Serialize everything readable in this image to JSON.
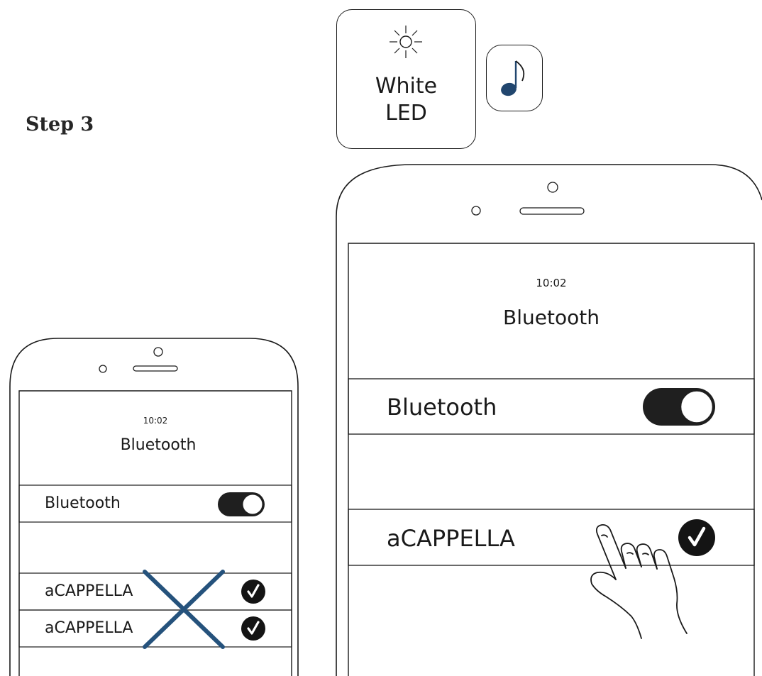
{
  "step": {
    "title": "Step 3"
  },
  "led": {
    "line1": "White",
    "line2": "LED"
  },
  "icons": {
    "sun": "sun-icon",
    "note": "music-note-icon",
    "check": "check-icon",
    "hand": "pointing-hand-icon",
    "cross": "cross-mark-icon"
  },
  "colors": {
    "note_blue": "#21466e",
    "cross_blue": "#25527c",
    "toggle_dark": "#1f1f1f"
  },
  "phone_small": {
    "time": "10:02",
    "screen_title": "Bluetooth",
    "toggle_row_label": "Bluetooth",
    "toggle_on": true,
    "devices": [
      {
        "label": "aCAPPELLA"
      },
      {
        "label": "aCAPPELLA"
      }
    ]
  },
  "phone_large": {
    "time": "10:02",
    "screen_title": "Bluetooth",
    "toggle_row_label": "Bluetooth",
    "toggle_on": true,
    "devices": [
      {
        "label": "aCAPPELLA"
      }
    ]
  }
}
